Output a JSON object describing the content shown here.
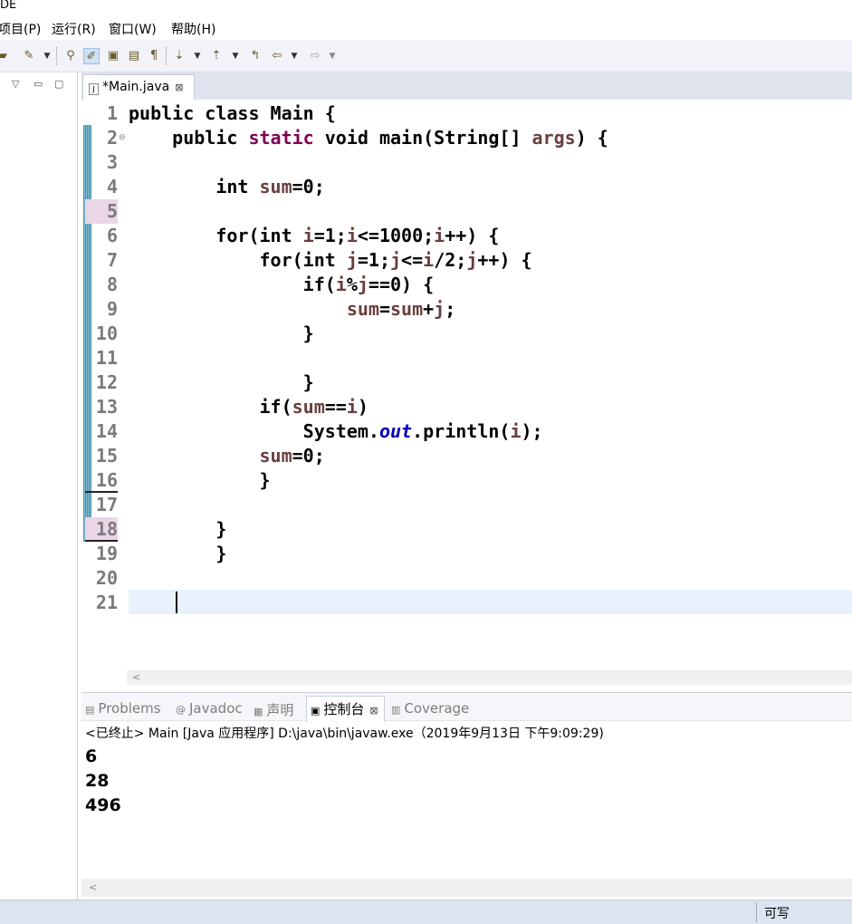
{
  "window": {
    "title_fragment": "DE"
  },
  "menu": {
    "items": [
      "项目(P)",
      "运行(R)",
      "窗口(W)",
      "帮助(H)"
    ]
  },
  "toolbar": {
    "icons": [
      "open-folder-icon",
      "run-icon",
      "dropdown-icon",
      "search-references-icon",
      "mark-occurrences-icon",
      "toggle-breadcrumb-icon",
      "block-selection-icon",
      "show-whitespace-icon",
      "next-annotation-icon",
      "dropdown-icon",
      "previous-annotation-icon",
      "dropdown-icon",
      "last-edit-icon",
      "back-icon",
      "dropdown-icon",
      "forward-icon",
      "dropdown-icon"
    ]
  },
  "left_panel": {
    "controls": [
      "▽",
      "▭",
      "▢"
    ]
  },
  "editor": {
    "tab": {
      "label": "*Main.java",
      "close": "⊠",
      "file_icon": "J"
    },
    "lines": [
      {
        "num": "1",
        "html": "public class Main {"
      },
      {
        "num": "2",
        "html": "    public <span class=\"kw\">static</span> void main(String[] <span class=\"v\">args</span>) {"
      },
      {
        "num": "3",
        "html": ""
      },
      {
        "num": "4",
        "html": "        int <span class=\"v\">sum</span>=0;"
      },
      {
        "num": "5",
        "html": ""
      },
      {
        "num": "6",
        "html": "        for(int <span class=\"v\">i</span>=1;<span class=\"v\">i</span>&lt;=1000;<span class=\"v\">i</span>++) {"
      },
      {
        "num": "7",
        "html": "            for(int <span class=\"v\">j</span>=1;<span class=\"v\">j</span>&lt;=<span class=\"v\">i</span>/2;<span class=\"v\">j</span>++) {"
      },
      {
        "num": "8",
        "html": "                if(<span class=\"v\">i</span>%<span class=\"v\">j</span>==0) {"
      },
      {
        "num": "9",
        "html": "                    <span class=\"v\">sum</span>=<span class=\"v\">sum</span>+<span class=\"v\">j</span>;"
      },
      {
        "num": "10",
        "html": "                }"
      },
      {
        "num": "11",
        "html": ""
      },
      {
        "num": "12",
        "html": "                }"
      },
      {
        "num": "13",
        "html": "            if(<span class=\"v\">sum</span>==<span class=\"v\">i</span>)"
      },
      {
        "num": "14",
        "html": "                System.<span class=\"st\">out</span>.println(<span class=\"v\">i</span>);"
      },
      {
        "num": "15",
        "html": "            <span class=\"v\">sum</span>=0;"
      },
      {
        "num": "16",
        "html": "            }"
      },
      {
        "num": "17",
        "html": ""
      },
      {
        "num": "18",
        "html": "        }"
      },
      {
        "num": "19",
        "html": "        }"
      },
      {
        "num": "20",
        "html": ""
      },
      {
        "num": "21",
        "html": ""
      }
    ],
    "highlighted_line_numbers": [
      "5",
      "18"
    ],
    "underlined_line_numbers": [
      "16",
      "18"
    ],
    "current_line": "21",
    "hscroll_arrow": "<"
  },
  "console": {
    "tabs": [
      {
        "label": "Problems",
        "icon": "problems-icon",
        "glyph": "▤",
        "active": false
      },
      {
        "label": "Javadoc",
        "icon": "javadoc-icon",
        "glyph": "@",
        "active": false
      },
      {
        "label": "声明",
        "icon": "declaration-icon",
        "glyph": "▦",
        "active": false
      },
      {
        "label": "控制台",
        "icon": "console-icon",
        "glyph": "▣",
        "active": true,
        "close": "⊠"
      },
      {
        "label": "Coverage",
        "icon": "coverage-icon",
        "glyph": "▥",
        "active": false
      }
    ],
    "description": "<已终止> Main [Java 应用程序] D:\\java\\bin\\javaw.exe（2019年9月13日 下午9:09:29)",
    "output": [
      "6",
      "28",
      "496"
    ],
    "hscroll_arrow": "<"
  },
  "status": {
    "writable": "可写"
  },
  "colors": {
    "keyword": "#7f0055",
    "variable": "#6a3e3e",
    "static_field": "#0000c0",
    "current_line": "#e8f2fe",
    "change_bar": "#5b9bb3"
  }
}
